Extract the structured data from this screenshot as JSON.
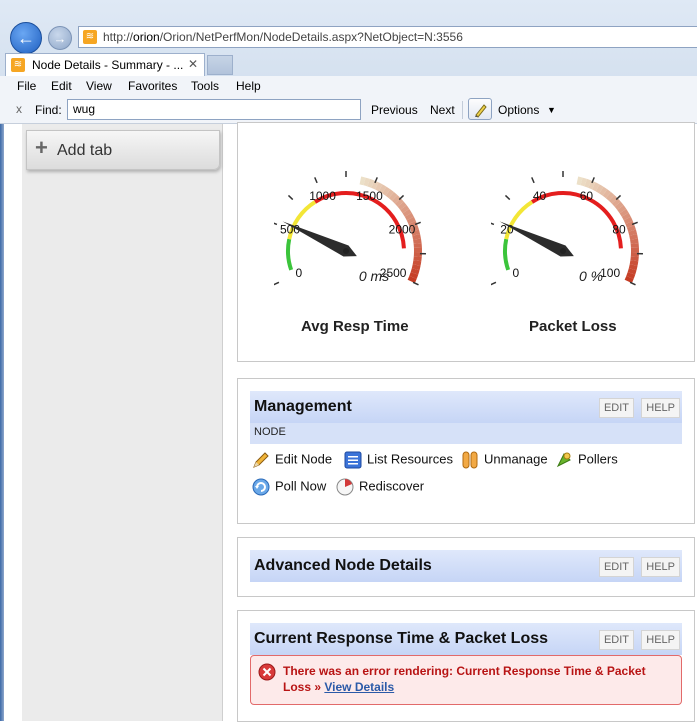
{
  "browser": {
    "url_prefix": "http://",
    "url_host": "orion",
    "url_path": "/Orion/NetPerfMon/NodeDetails.aspx?NetObject=N:3556",
    "tab_title": "Node Details - Summary - ...",
    "tab_close": "✕",
    "menu": [
      "File",
      "Edit",
      "View",
      "Favorites",
      "Tools",
      "Help"
    ],
    "find_close": "x",
    "find_label": "Find:",
    "find_value": "wug",
    "find_prev": "Previous",
    "find_next": "Next",
    "options_label": "Options",
    "options_arrow": "▼"
  },
  "sidebar": {
    "add_tab_label": "Add tab"
  },
  "gauges": [
    {
      "name": "Avg Resp Time",
      "ticks": [
        "0",
        "500",
        "1000",
        "1500",
        "2000",
        "2500"
      ],
      "value_text": "0 ms",
      "max": 2500,
      "value": 0
    },
    {
      "name": "Packet Loss",
      "ticks": [
        "0",
        "20",
        "40",
        "60",
        "80",
        "100"
      ],
      "value_text": "0 %",
      "max": 100,
      "value": 0
    }
  ],
  "management": {
    "title": "Management",
    "edit": "EDIT",
    "help": "HELP",
    "section": "NODE",
    "actions": [
      "Edit Node",
      "List Resources",
      "Unmanage",
      "Pollers",
      "Poll Now",
      "Rediscover"
    ]
  },
  "advanced": {
    "title": "Advanced Node Details",
    "edit": "EDIT",
    "help": "HELP"
  },
  "current": {
    "title": "Current Response Time & Packet Loss",
    "edit": "EDIT",
    "help": "HELP",
    "error_text": "There was an error rendering: Current Response Time & Packet Loss »",
    "error_link": "View Details"
  },
  "colors": {
    "header": "#c6d5f6",
    "error": "#b81414",
    "link": "#2b5aa8"
  }
}
